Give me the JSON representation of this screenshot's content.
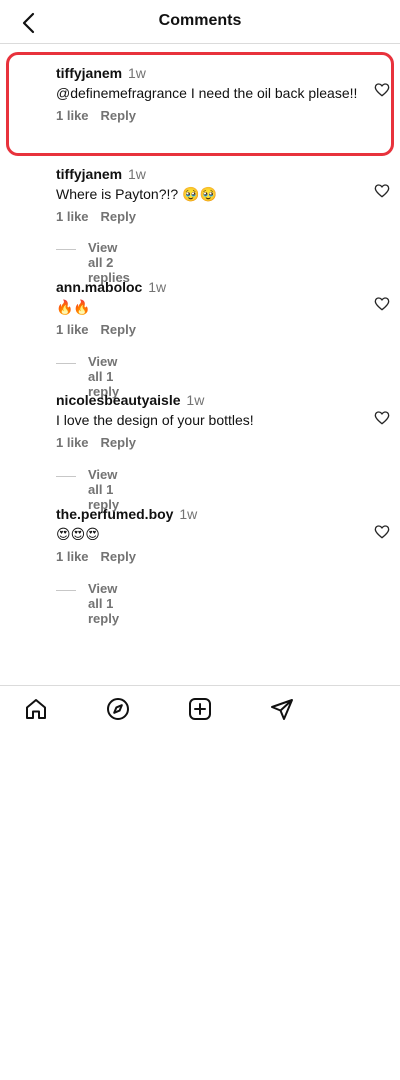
{
  "header": {
    "title": "Comments"
  },
  "comments": [
    {
      "username": "tiffyjanem",
      "time": "1w",
      "text": "@definemefragrance I need the oil back please!!",
      "likes": "1 like",
      "reply_label": "Reply",
      "view_replies": null
    },
    {
      "username": "tiffyjanem",
      "time": "1w",
      "text": "Where is Payton?!? 🥹🥹",
      "likes": "1 like",
      "reply_label": "Reply",
      "view_replies": "View all 2 replies"
    },
    {
      "username": "ann.maboloc",
      "time": "1w",
      "text": "🔥🔥",
      "likes": "1 like",
      "reply_label": "Reply",
      "view_replies": "View all 1 reply"
    },
    {
      "username": "nicolesbeautyaisle",
      "time": "1w",
      "text": "I love the design of your bottles!",
      "likes": "1 like",
      "reply_label": "Reply",
      "view_replies": "View all 1 reply"
    },
    {
      "username": "the.perfumed.boy",
      "time": "1w",
      "text": "😍😍😍",
      "likes": "1 like",
      "reply_label": "Reply",
      "view_replies": "View all 1 reply"
    }
  ],
  "bottom_nav": {
    "items": [
      "home-icon",
      "explore-icon",
      "create-icon",
      "direct-message-icon"
    ]
  },
  "colors": {
    "highlight": "#e8323c",
    "muted": "#737373",
    "divider": "#dbdbdb"
  }
}
